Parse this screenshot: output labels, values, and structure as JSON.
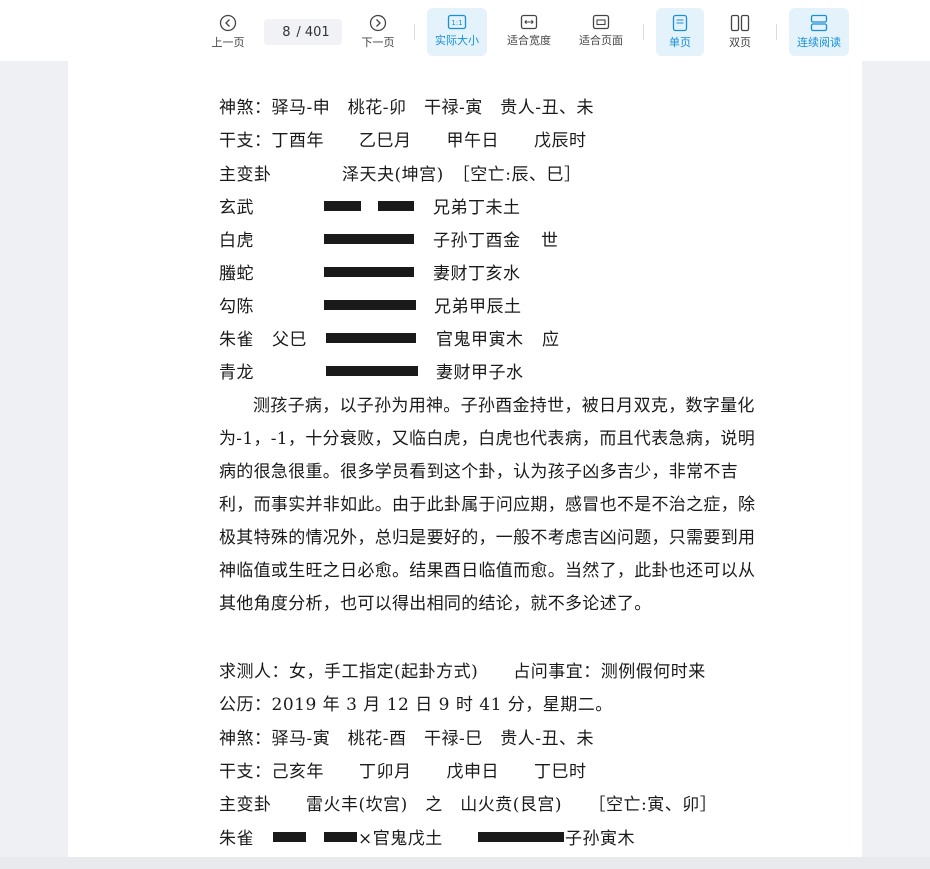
{
  "toolbar": {
    "prev": "上一页",
    "next": "下一页",
    "current_page": "8",
    "total_pages": "/ 401",
    "actual_size": "实际大小",
    "actual_size_glyph": "1:1",
    "fit_width": "适合宽度",
    "fit_page": "适合页面",
    "single_page": "单页",
    "double_page": "双页",
    "continuous": "连续阅读",
    "accent_color": "#1790d6"
  },
  "doc": {
    "l1": "神煞：驿马-申　桃花-卯　干禄-寅　贵人-丑、未",
    "l2": "干支：丁酉年　　乙巳月　　甲午日　　戊辰时",
    "l3a": "主变卦",
    "l3b": "泽天夬(坤宫)　［空亡:辰、巳］",
    "yao": [
      {
        "god": "玄武",
        "hidden": "",
        "text": "兄弟丁未土",
        "mark": ""
      },
      {
        "god": "白虎",
        "hidden": "",
        "text": "子孙丁酉金",
        "mark": "世"
      },
      {
        "god": "螣蛇",
        "hidden": "",
        "text": "妻财丁亥水",
        "mark": ""
      },
      {
        "god": "勾陈",
        "hidden": "",
        "text": "兄弟甲辰土",
        "mark": ""
      },
      {
        "god": "朱雀",
        "hidden": "父巳",
        "text": "官鬼甲寅木",
        "mark": "应"
      },
      {
        "god": "青龙",
        "hidden": "",
        "text": "妻财甲子水",
        "mark": ""
      }
    ],
    "para": "测孩子病，以子孙为用神。子孙酉金持世，被日月双克，数字量化为-1，-1，十分衰败，又临白虎，白虎也代表病，而且代表急病，说明病的很急很重。很多学员看到这个卦，认为孩子凶多吉少，非常不吉利，而事实并非如此。由于此卦属于问应期，感冒也不是不治之症，除极其特殊的情况外，总归是要好的，一般不考虑吉凶问题，只需要到用神临值或生旺之日必愈。结果酉日临值而愈。当然了，此卦也还可以从其他角度分析，也可以得出相同的结论，就不多论述了。",
    "q1": "求测人：女，手工指定(起卦方式)　　占问事宜：测例假何时来",
    "q2": "公历：2019 年 3 月 12 日 9 时 41 分，星期二。",
    "q3": "神煞：驿马-寅　桃花-酉　干禄-巳　贵人-丑、未",
    "q4": "干支：己亥年　　丁卯月　　戊申日　　丁巳时",
    "q5a": "主变卦",
    "q5b": "雷火丰(坎宫)　之　山火贲(艮宫)　　［空亡:寅、卯］",
    "q6a": "朱雀",
    "q6b": "×官鬼戊土",
    "q6c": "子孙寅木"
  }
}
